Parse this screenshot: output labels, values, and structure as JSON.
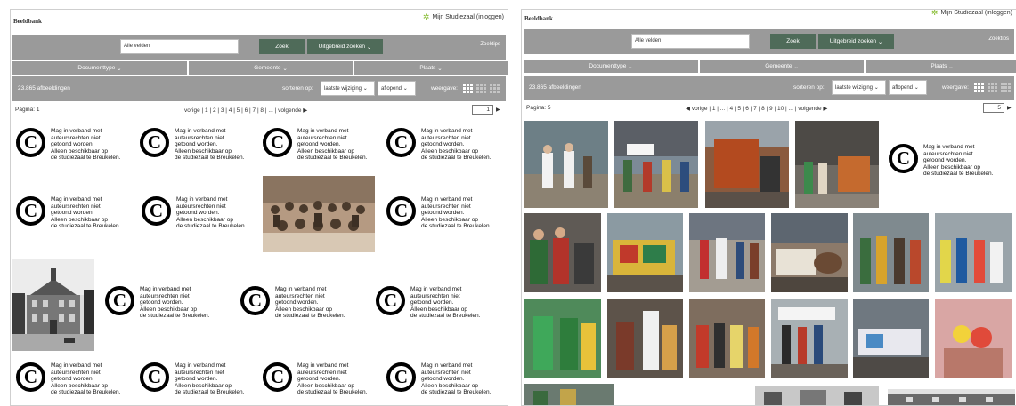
{
  "common": {
    "app_title": "Beeldbank",
    "login_label": "Mijn Studiezaal (inloggen)",
    "search_value": "Alle velden",
    "search_button": "Zoek",
    "advanced_button": "Uitgebreid zoeken",
    "tips_link": "Zoektips",
    "filters": [
      "Documenttype",
      "Gemeente",
      "Plaats"
    ],
    "result_count": "23.865 afbeeldingen",
    "sort_label": "sorteren op:",
    "sort_field": "laatste wijziging",
    "sort_order": "aflopend",
    "view_label": "weergave:",
    "copyright_notice": "Mag in verband met\nauteursrechten niet\ngetoond worden.\nAlleen beschikbaar op\nde studiezaal te Breukelen.",
    "prev_label": "vorige",
    "next_label": "volgende"
  },
  "left": {
    "page_label": "Pagina: 1",
    "page_links": "| 1 | 2 | 3 | 4 | 5 | 6 | 7 | 8 | ... |",
    "page_input": "1"
  },
  "right": {
    "page_label": "Pagina: 5",
    "page_links": "| 1 | ... | 4 | 5 | 6 | 7 | 8 | 9 | 10 | ... |",
    "page_input": "5"
  },
  "colors": {
    "toolbar_gray": "#9a9a9a",
    "button_green": "#4f6b59",
    "accent_star": "#8bbf3a"
  }
}
